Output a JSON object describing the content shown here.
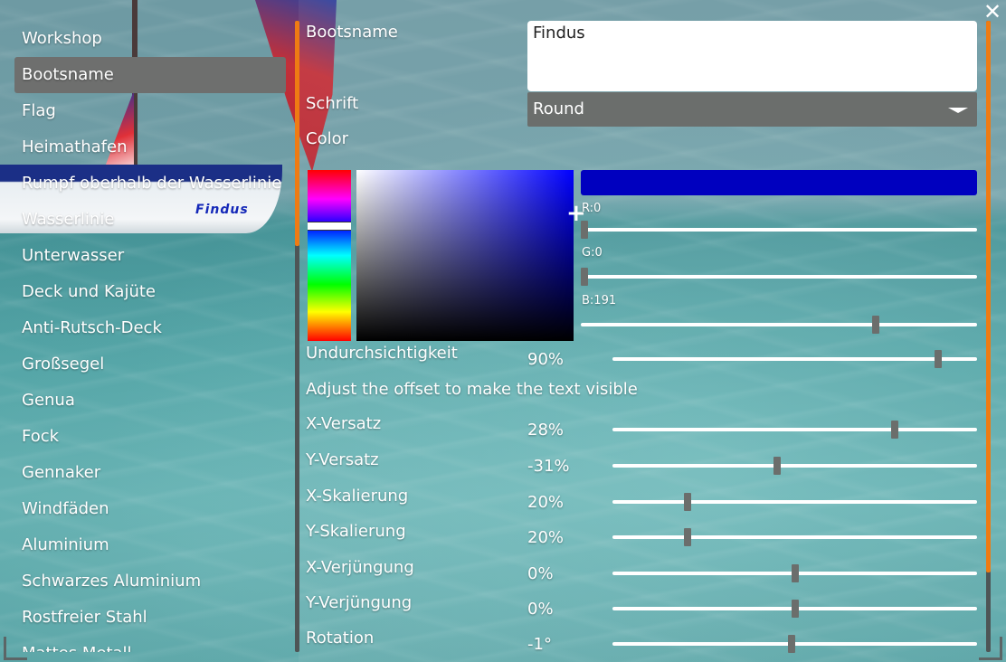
{
  "window": {
    "close_label": "✕"
  },
  "boat": {
    "hull_name": "Findus"
  },
  "menu": {
    "items": [
      {
        "label": "Workshop"
      },
      {
        "label": "Bootsname",
        "selected": true
      },
      {
        "label": "Flag"
      },
      {
        "label": "Heimathafen"
      },
      {
        "label": "Rumpf oberhalb der Wasserlinie"
      },
      {
        "label": "Wasserlinie"
      },
      {
        "label": "Unterwasser"
      },
      {
        "label": "Deck und Kajüte"
      },
      {
        "label": "Anti-Rutsch-Deck"
      },
      {
        "label": "Großsegel"
      },
      {
        "label": "Genua"
      },
      {
        "label": "Fock"
      },
      {
        "label": "Gennaker"
      },
      {
        "label": "Windfäden"
      },
      {
        "label": "Aluminium"
      },
      {
        "label": "Schwarzes Aluminium"
      },
      {
        "label": "Rostfreier Stahl"
      },
      {
        "label": "Mattes Metall"
      }
    ],
    "scroll_fraction": 0.32
  },
  "form": {
    "boat_name_label": "Bootsname",
    "boat_name_value": "Findus",
    "font_label": "Schrift",
    "font_value": "Round",
    "color_label": "Color",
    "opacity_label": "Undurchsichtigkeit",
    "opacity_value": "90%",
    "offset_hint": "Adjust the offset to make the text visible"
  },
  "color": {
    "current_hex": "#0000bf",
    "r_label": "R:0",
    "r": 0,
    "g_label": "G:0",
    "g": 0,
    "b_label": "B:191",
    "b": 191,
    "hue_fraction": 0.33,
    "sv_saturation": 1.0,
    "sv_value": 0.75
  },
  "sliders": [
    {
      "key": "opacity",
      "fraction": 0.9
    },
    {
      "key": "x_offset",
      "label": "X-Versatz",
      "value": "28%",
      "fraction": 0.78
    },
    {
      "key": "y_offset",
      "label": "Y-Versatz",
      "value": "-31%",
      "fraction": 0.45
    },
    {
      "key": "x_scale",
      "label": "X-Skalierung",
      "value": "20%",
      "fraction": 0.2
    },
    {
      "key": "y_scale",
      "label": "Y-Skalierung",
      "value": "20%",
      "fraction": 0.2
    },
    {
      "key": "x_taper",
      "label": "X-Verjüngung",
      "value": "0%",
      "fraction": 0.5
    },
    {
      "key": "y_taper",
      "label": "Y-Verjüngung",
      "value": "0%",
      "fraction": 0.5
    },
    {
      "key": "rotation",
      "label": "Rotation",
      "value": "-1°",
      "fraction": 0.49
    }
  ],
  "panel_scroll_fraction": 0.0,
  "accent_color": "#ee7b13"
}
